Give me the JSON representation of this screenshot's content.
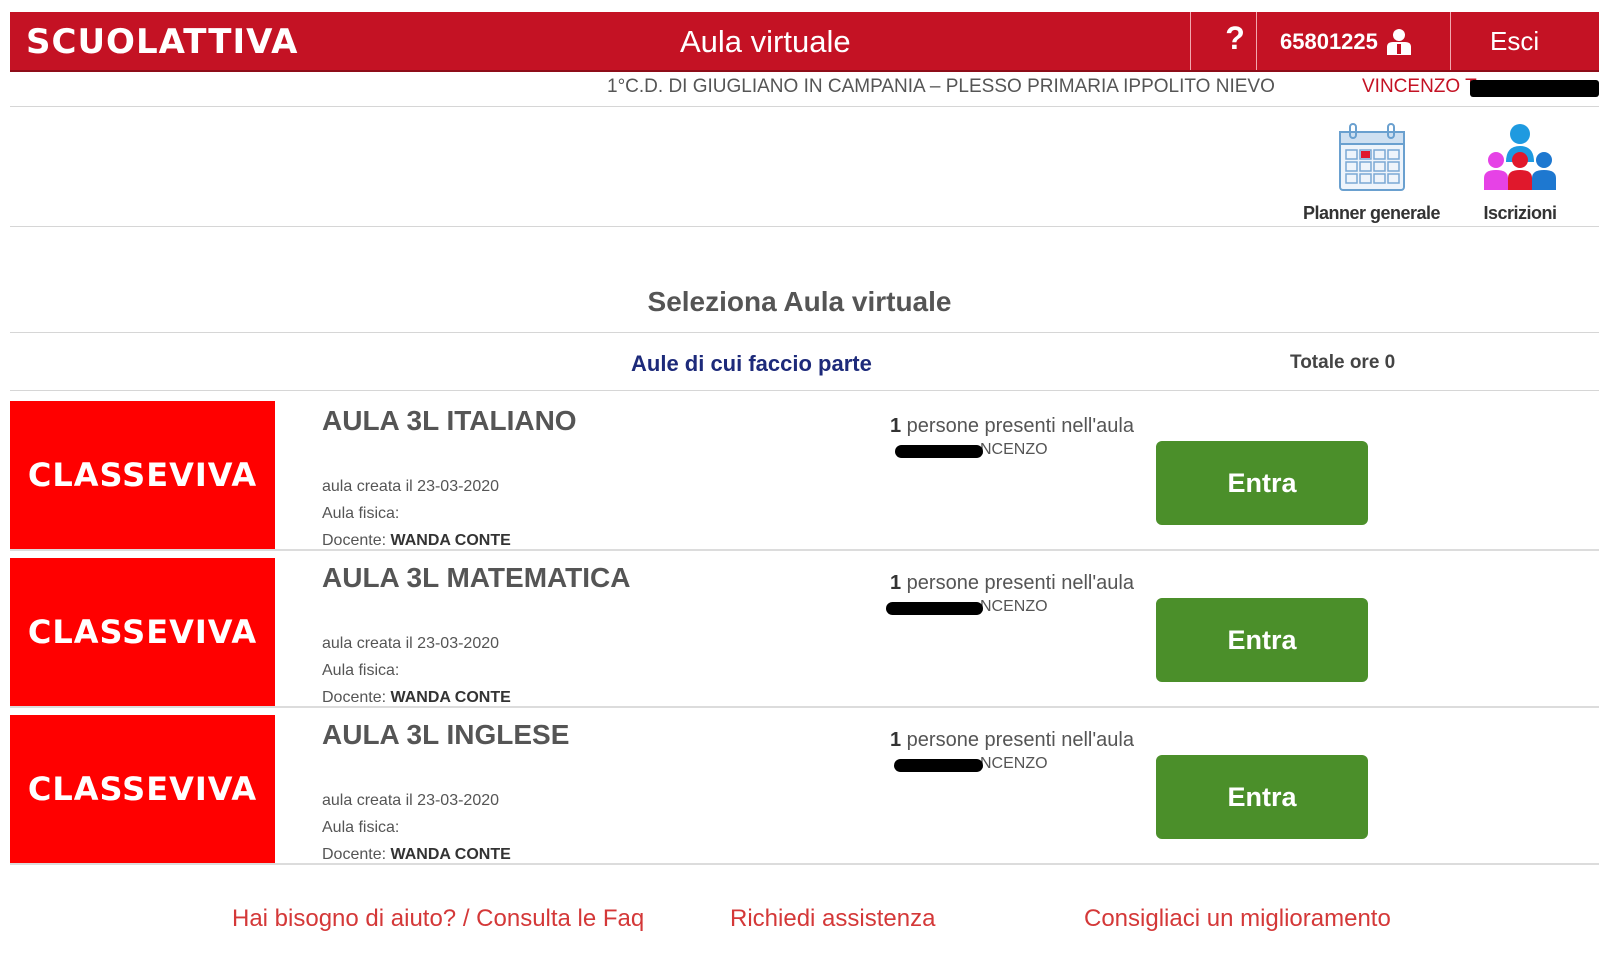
{
  "header": {
    "brand": "SCUOLATTIVA",
    "title": "Aula virtuale",
    "help_label": "?",
    "user_code": "65801225",
    "logout_label": "Esci",
    "school": "1°C.D. DI GIUGLIANO IN CAMPANIA – PLESSO PRIMARIA IPPOLITO NIEVO",
    "user_name": "VINCENZO T"
  },
  "shortcuts": [
    {
      "label": "Planner generale",
      "icon": "calendar-icon"
    },
    {
      "label": "Iscrizioni",
      "icon": "people-icon"
    }
  ],
  "main": {
    "section_title": "Seleziona Aula virtuale",
    "tab_label": "Aule di cui faccio parte",
    "total_hours": "Totale ore 0"
  },
  "rooms": [
    {
      "logo_text": "CLASSEVIVA",
      "title": "AULA 3L ITALIANO",
      "presence_count": "1",
      "presence_text": " persone presenti nell'aula",
      "presence_name": "NCENZO",
      "created": "aula creata il 23-03-2020",
      "physical": "Aula fisica:",
      "teacher_label": "Docente: ",
      "teacher": "WANDA CONTE",
      "button": "Entra"
    },
    {
      "logo_text": "CLASSEVIVA",
      "title": "AULA 3L MATEMATICA",
      "presence_count": "1",
      "presence_text": " persone presenti nell'aula",
      "presence_name": "NCENZO",
      "created": "aula creata il 23-03-2020",
      "physical": "Aula fisica:",
      "teacher_label": "Docente: ",
      "teacher": "WANDA CONTE",
      "button": "Entra"
    },
    {
      "logo_text": "CLASSEVIVA",
      "title": "AULA 3L INGLESE",
      "presence_count": "1",
      "presence_text": " persone presenti nell'aula",
      "presence_name": "NCENZO",
      "created": "aula creata il 23-03-2020",
      "physical": "Aula fisica:",
      "teacher_label": "Docente: ",
      "teacher": "WANDA CONTE",
      "button": "Entra"
    }
  ],
  "footer": {
    "help": "Hai bisogno di aiuto? / Consulta le Faq",
    "assist": "Richiedi assistenza",
    "suggest": "Consigliaci un miglioramento"
  },
  "colors": {
    "brand_red": "#c41224",
    "logo_red": "#ff0000",
    "enter_green": "#4b8f2a",
    "tab_blue": "#1d2a7a",
    "link_red": "#d43838"
  }
}
